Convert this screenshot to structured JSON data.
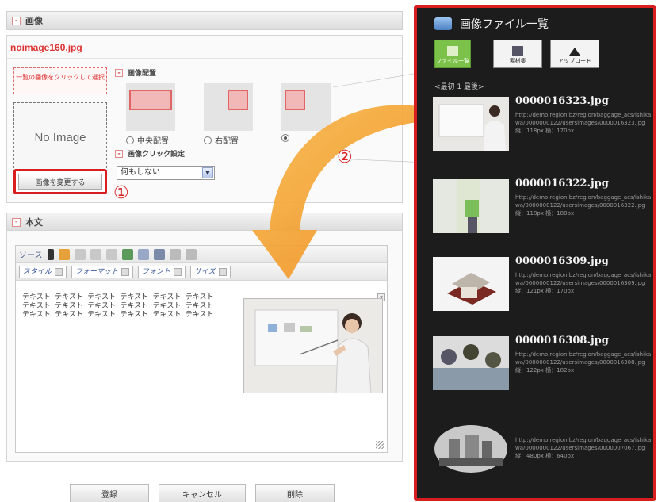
{
  "image_section": {
    "title": "画像",
    "filename": "noimage160.jpg",
    "hint": "一覧の画像をクリックして選択",
    "no_image": "No Image",
    "change_button": "画像を変更する",
    "marker1": "①",
    "layout_title": "画像配置",
    "radios": [
      {
        "label": "中央配置",
        "checked": false
      },
      {
        "label": "右配置",
        "checked": false
      },
      {
        "label": "",
        "checked": true
      }
    ],
    "click_title": "画像クリック設定",
    "click_value": "何もしない"
  },
  "body_section": {
    "title": "本文",
    "toolbar": {
      "source": "ソース",
      "style": "スタイル",
      "format": "フォーマット",
      "font": "フォント",
      "size": "サイズ"
    },
    "content": "テキスト テキスト テキスト テキスト テキスト テキスト\nテキスト テキスト テキスト テキスト テキスト テキスト\nテキスト テキスト テキスト テキスト テキスト テキスト"
  },
  "marker2": "②",
  "buttons": {
    "register": "登録",
    "cancel": "キャンセル",
    "delete": "削除"
  },
  "list_panel": {
    "title": "画像ファイル一覧",
    "buttons": [
      "ファイル一覧",
      "素材集",
      "アップロード"
    ],
    "pager_first": "<最初",
    "pager_page": "1",
    "pager_last": "最後>",
    "items": [
      {
        "name": "0000016323.jpg",
        "meta": "http://demo.region.bz/region/baggage_acs/ishikawa/0000000122/usersimages/0000016323.jpg 縦：118px 横：170px"
      },
      {
        "name": "0000016322.jpg",
        "meta": "http://demo.region.bz/region/baggage_acs/ishikawa/0000000122/usersimages/0000016322.jpg 縦：118px 横：180px"
      },
      {
        "name": "0000016309.jpg",
        "meta": "http://demo.region.bz/region/baggage_acs/ishikawa/0000000122/usersimages/0000016309.jpg 縦：121px 横：170px"
      },
      {
        "name": "0000016308.jpg",
        "meta": "http://demo.region.bz/region/baggage_acs/ishikawa/0000000122/usersimages/0000016308.jpg 縦：122px 横：182px"
      },
      {
        "name": "",
        "meta": "http://demo.region.bz/region/baggage_acs/ishikawa/0000000122/usersimages/0000007067.jpg 縦：480px 横：640px"
      }
    ]
  },
  "colors": {
    "accent_red": "#d81e1e",
    "arrow_orange": "#f5a623",
    "panel_dark": "#1c1c1c"
  }
}
